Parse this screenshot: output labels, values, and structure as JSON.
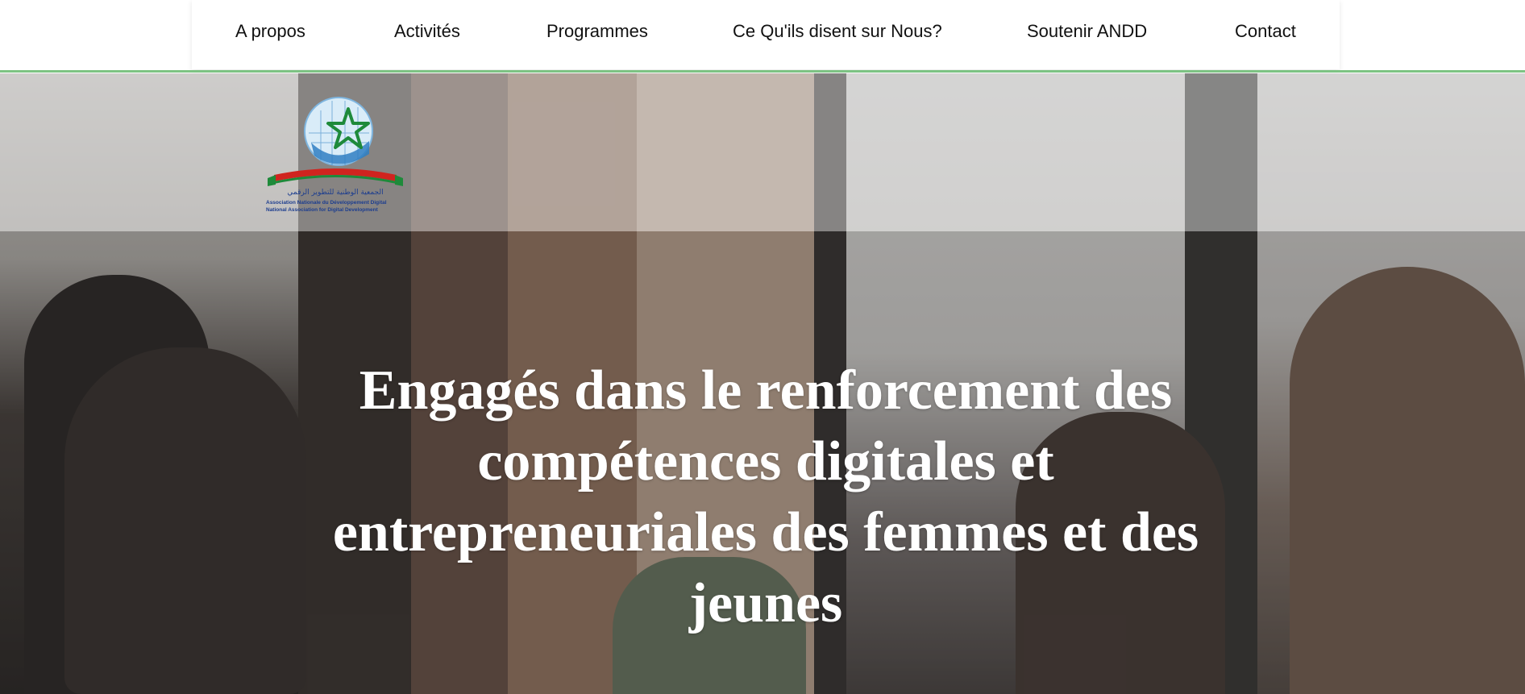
{
  "nav": {
    "items": [
      {
        "label": "A propos"
      },
      {
        "label": "Activités"
      },
      {
        "label": "Programmes"
      },
      {
        "label": "Ce Qu'ils disent sur Nous?"
      },
      {
        "label": "Soutenir ANDD"
      },
      {
        "label": "Contact"
      }
    ]
  },
  "logo": {
    "arabic_text": "الجمعية الوطنية للتطوير الرقمي",
    "line_fr": "Association Nationale du Développement Digital",
    "line_en": "National Association for Digital Development"
  },
  "hero": {
    "title": "Engagés dans le renforcement des compétences digitales et entrepreneuriales des femmes et des jeunes"
  },
  "colors": {
    "accent_line": "#7dc383",
    "nav_text": "#111111",
    "title_text": "#ffffff",
    "logo_star": "#1e8a3a",
    "logo_ribbon": "#d0241f",
    "logo_globe": "#2f7fc3"
  }
}
